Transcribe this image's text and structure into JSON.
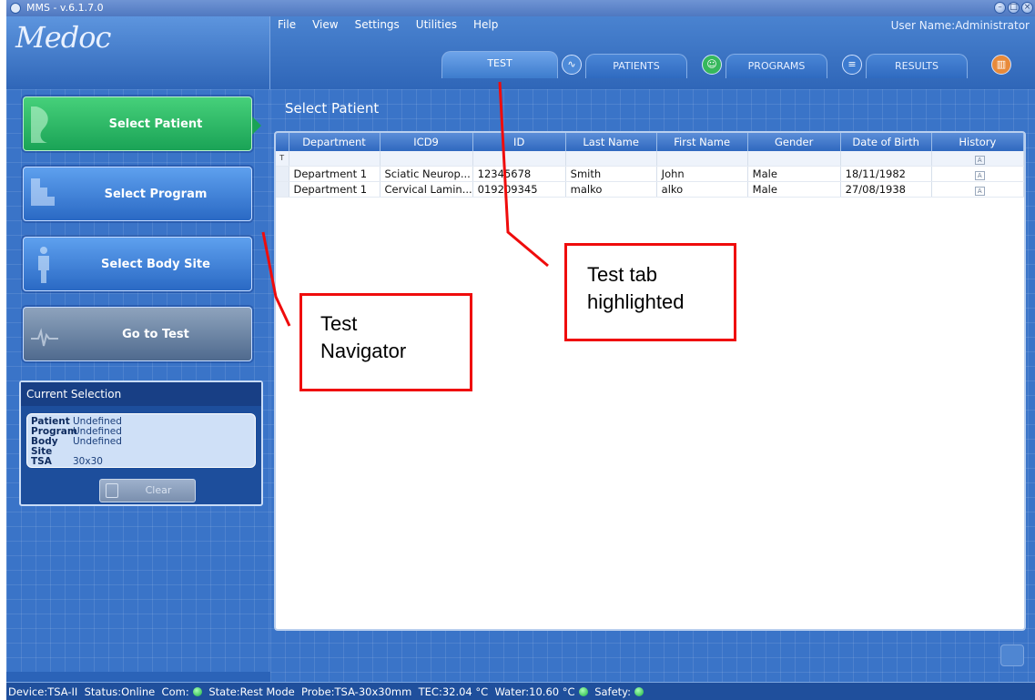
{
  "window": {
    "title": "MMS - v.6.1.7.0",
    "buttons": [
      "–",
      "□",
      "×"
    ]
  },
  "header": {
    "logo": "Medoc",
    "menu": [
      "File",
      "View",
      "Settings",
      "Utilities",
      "Help"
    ],
    "user": "User Name:Administrator",
    "tabs": [
      {
        "label": "TEST",
        "active": true
      },
      {
        "label": "PATIENTS"
      },
      {
        "label": "PROGRAMS"
      },
      {
        "label": "RESULTS"
      }
    ]
  },
  "nav": {
    "items": [
      {
        "label": "Select Patient",
        "state": "active"
      },
      {
        "label": "Select Program"
      },
      {
        "label": "Select Body Site"
      },
      {
        "label": "Go to Test",
        "state": "dim"
      }
    ]
  },
  "current_selection": {
    "title": "Current Selection",
    "rows": [
      {
        "key": "Patient",
        "value": "Undefined"
      },
      {
        "key": "Program",
        "value": "Undefined"
      },
      {
        "key": "Body Site",
        "value": "Undefined"
      },
      {
        "key": "TSA",
        "value": "30x30"
      }
    ],
    "clear_label": "Clear"
  },
  "content": {
    "title": "Select Patient",
    "columns": [
      "Department",
      "ICD9",
      "ID",
      "Last Name",
      "First Name",
      "Gender",
      "Date of Birth",
      "History"
    ],
    "rows": [
      [
        "Department 1",
        "Sciatic Neurop...",
        "12345678",
        "Smith",
        "John",
        "Male",
        "18/11/1982",
        ""
      ],
      [
        "Department 1",
        "Cervical Lamin...",
        "019209345",
        "malko",
        "alko",
        "Male",
        "27/08/1938",
        ""
      ]
    ],
    "filter_marker": "T",
    "history_icon": "A"
  },
  "status": {
    "device": "Device:TSA-II",
    "status": "Status:Online",
    "com": "Com:",
    "state": "State:Rest Mode",
    "probe": "Probe:TSA-30x30mm",
    "tec": "TEC:32.04 °C",
    "water": "Water:10.60 °C",
    "safety": "Safety:"
  },
  "annotations": {
    "nav": "Test\nNavigator",
    "tab": "Test tab\nhighlighted",
    "color": "#ef0c0c"
  }
}
